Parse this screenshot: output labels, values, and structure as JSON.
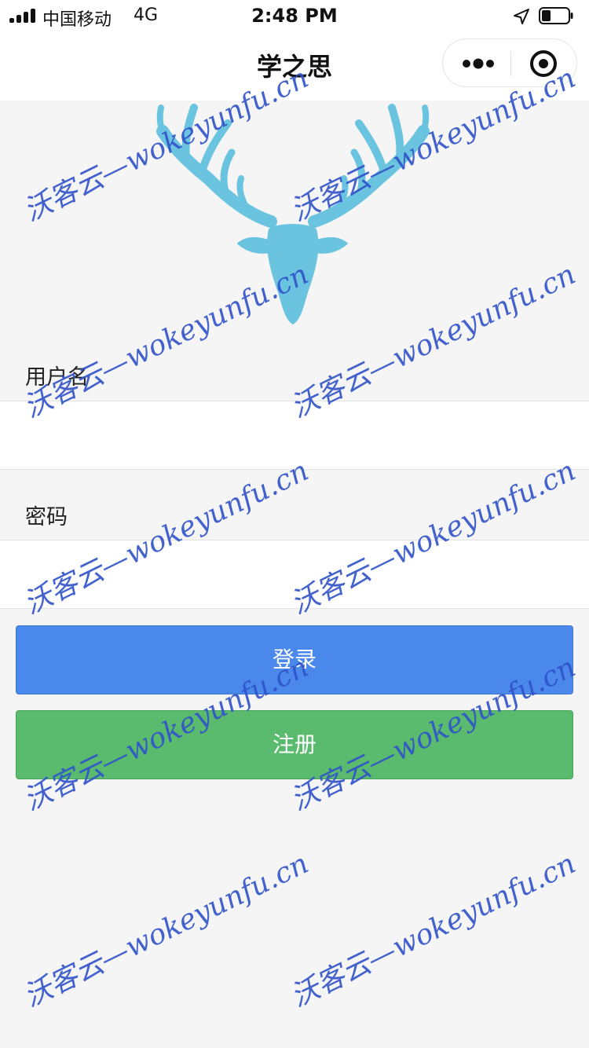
{
  "status_bar": {
    "carrier": "中国移动",
    "network": "4G",
    "time": "2:48 PM"
  },
  "nav": {
    "title": "学之思"
  },
  "form": {
    "username_label": "用户名",
    "username_value": "",
    "password_label": "密码",
    "password_value": ""
  },
  "buttons": {
    "login": "登录",
    "register": "注册"
  },
  "watermark": {
    "text": "沃客云—wokeyunfu.cn",
    "color": "#2f52c9"
  },
  "colors": {
    "login_button": "#4a88eb",
    "register_button": "#5abb6e",
    "logo": "#6bc4df",
    "background": "#f5f5f5"
  },
  "icons": [
    "signal-icon",
    "location-arrow-icon",
    "battery-icon",
    "more-icon",
    "target-icon",
    "deer-logo"
  ]
}
